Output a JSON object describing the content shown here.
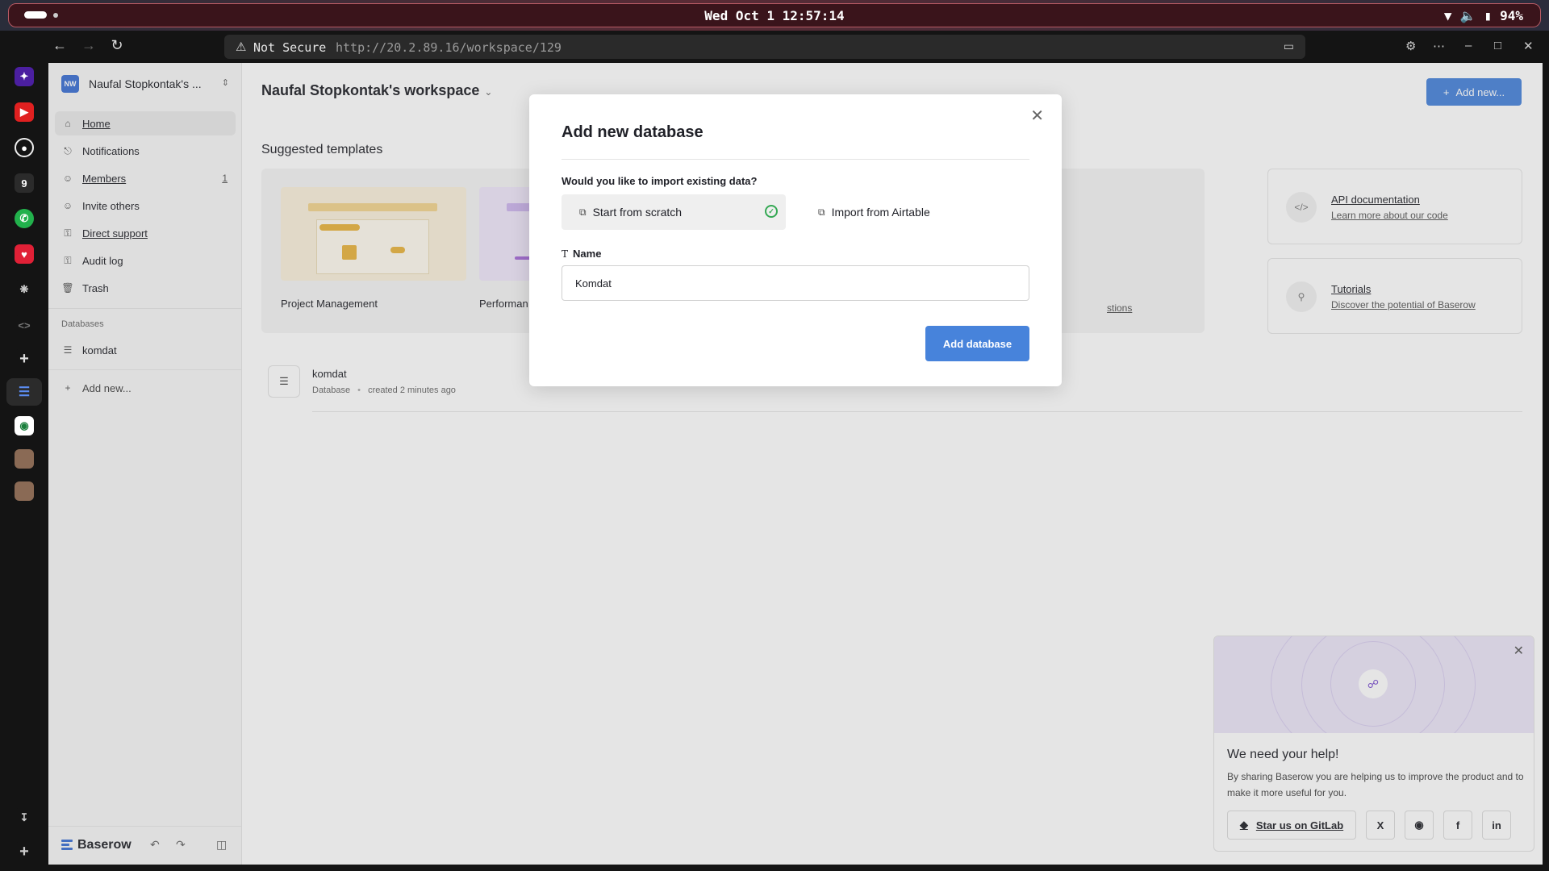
{
  "os": {
    "clock": "Wed Oct 1 12:57:14",
    "battery": "94%"
  },
  "browser": {
    "security_label": "Not Secure",
    "url": "http://20.2.89.16/workspace/129"
  },
  "sidebar": {
    "workspace_initials": "NW",
    "workspace_name": "Naufal Stopkontak's ...",
    "items": [
      {
        "label": "Home",
        "icon": "home-icon"
      },
      {
        "label": "Notifications",
        "icon": "bell-icon"
      },
      {
        "label": "Members",
        "icon": "users-icon",
        "count": "1"
      },
      {
        "label": "Invite others",
        "icon": "user-plus-icon"
      },
      {
        "label": "Direct support",
        "icon": "lock-icon"
      },
      {
        "label": "Audit log",
        "icon": "lock-icon"
      },
      {
        "label": "Trash",
        "icon": "trash-icon"
      }
    ],
    "databases_title": "Databases",
    "databases": [
      "komdat"
    ],
    "add_new": "Add new...",
    "logo": "Baserow"
  },
  "main": {
    "workspace_title": "Naufal Stopkontak's workspace",
    "add_new_button": "Add new...",
    "suggested_title": "Suggested templates",
    "templates": [
      "Project Management",
      "Performan"
    ],
    "partial_link": "stions",
    "links": [
      {
        "title": "API documentation",
        "subtitle": "Learn more about our code",
        "icon": "code-icon"
      },
      {
        "title": "Tutorials",
        "subtitle": "Discover the potential of Baserow",
        "icon": "lightbulb-icon"
      }
    ],
    "database_row": {
      "name": "komdat",
      "type": "Database",
      "created": "created 2 minutes ago"
    }
  },
  "modal": {
    "title": "Add new database",
    "question": "Would you like to import existing data?",
    "option_scratch": "Start from scratch",
    "option_airtable": "Import from Airtable",
    "name_label": "Name",
    "name_value": "Komdat",
    "submit": "Add database"
  },
  "help_card": {
    "title": "We need your help!",
    "text": "By sharing Baserow you are helping us to improve the product and to make it more useful for you.",
    "gitlab_button": "Star us on GitLab",
    "socials": [
      "X",
      "reddit",
      "f",
      "in"
    ]
  },
  "colors": {
    "accent": "#4783db",
    "success": "#34a853"
  }
}
